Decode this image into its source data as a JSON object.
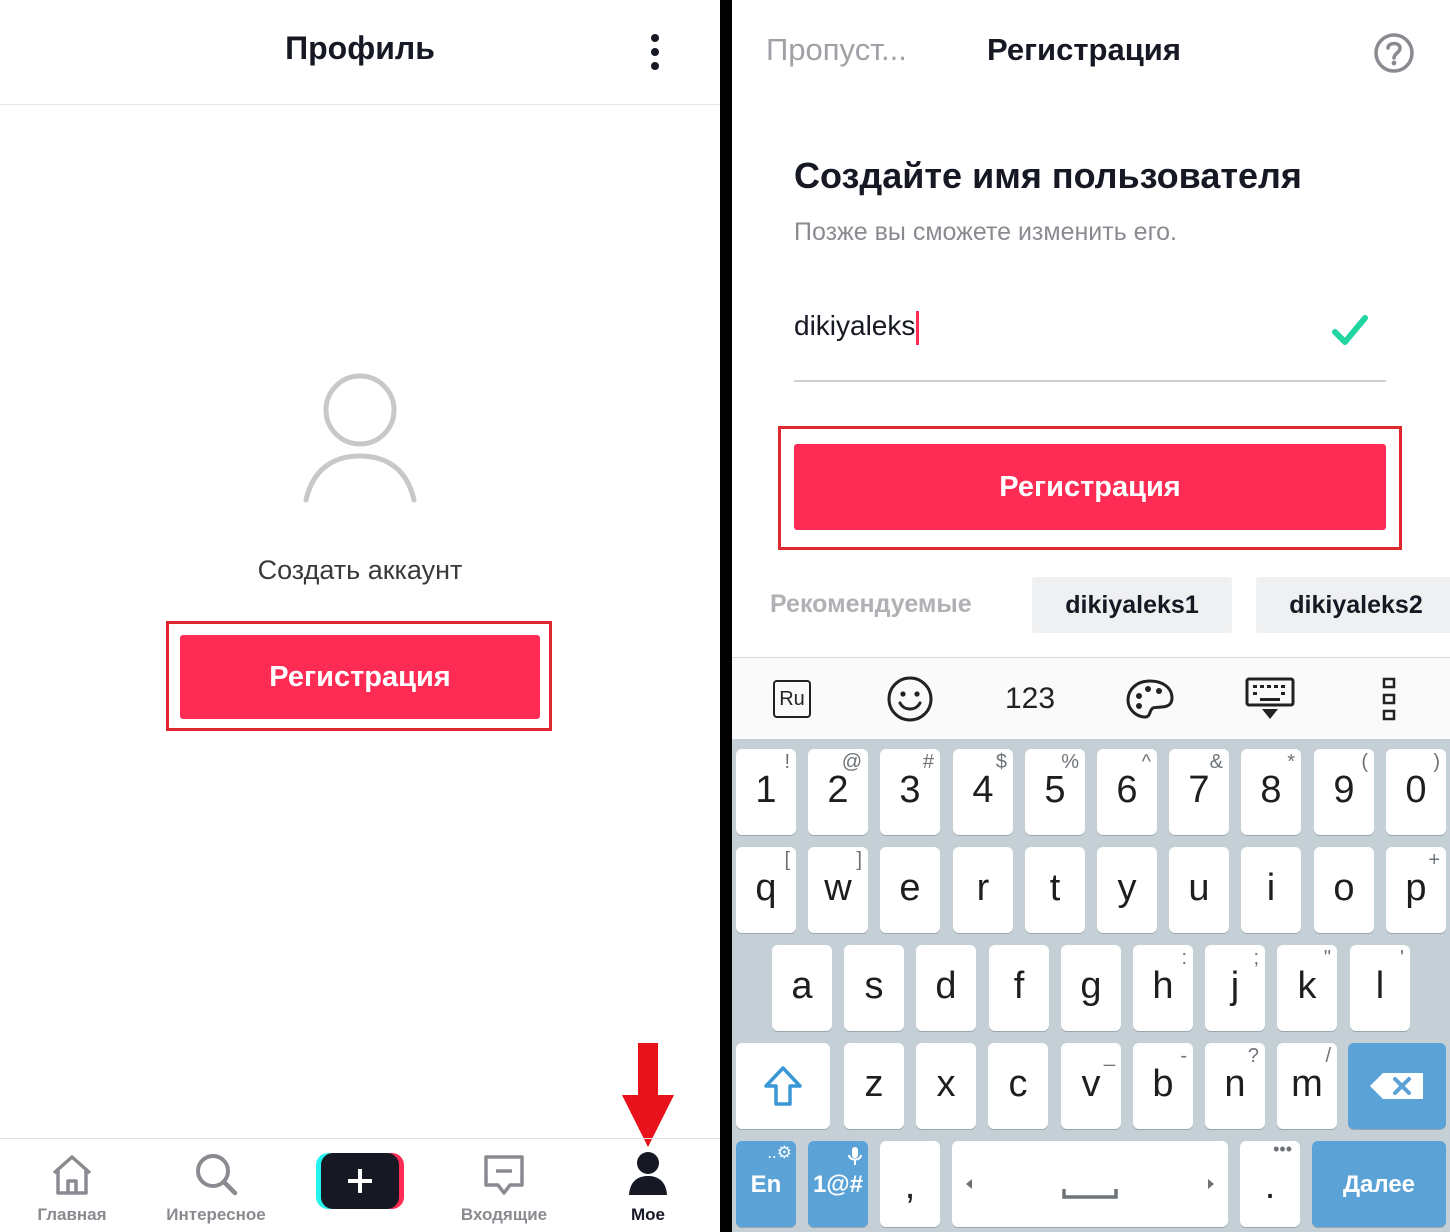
{
  "left": {
    "header": {
      "title": "Профиль"
    },
    "create_account_text": "Создать аккаунт",
    "register_button": "Регистрация",
    "tabs": [
      {
        "label": "Главная",
        "icon": "home-icon"
      },
      {
        "label": "Интересное",
        "icon": "search-icon"
      },
      {
        "label": "",
        "icon": "plus-icon"
      },
      {
        "label": "Входящие",
        "icon": "inbox-icon"
      },
      {
        "label": "Мое",
        "icon": "person-icon"
      }
    ],
    "active_tab": "Мое"
  },
  "right": {
    "header": {
      "skip": "Пропуст...",
      "title": "Регистрация"
    },
    "heading": "Создайте имя пользователя",
    "subheading": "Позже вы сможете изменить его.",
    "username_value": "dikiyaleks",
    "register_button": "Регистрация",
    "recommended_label": "Рекомендуемые",
    "suggestions": [
      "dikiyaleks1",
      "dikiyaleks2"
    ]
  },
  "keyboard": {
    "toolbar": {
      "lang": "Ru",
      "numbers": "123"
    },
    "row1": [
      {
        "k": "1",
        "s": "!"
      },
      {
        "k": "2",
        "s": "@"
      },
      {
        "k": "3",
        "s": "#"
      },
      {
        "k": "4",
        "s": "$"
      },
      {
        "k": "5",
        "s": "%"
      },
      {
        "k": "6",
        "s": "^"
      },
      {
        "k": "7",
        "s": "&"
      },
      {
        "k": "8",
        "s": "*"
      },
      {
        "k": "9",
        "s": "("
      },
      {
        "k": "0",
        "s": ")"
      }
    ],
    "row2": [
      {
        "k": "q",
        "s": "["
      },
      {
        "k": "w",
        "s": "]"
      },
      {
        "k": "e",
        "s": ""
      },
      {
        "k": "r",
        "s": ""
      },
      {
        "k": "t",
        "s": ""
      },
      {
        "k": "y",
        "s": ""
      },
      {
        "k": "u",
        "s": ""
      },
      {
        "k": "i",
        "s": ""
      },
      {
        "k": "o",
        "s": ""
      },
      {
        "k": "p",
        "s": "+"
      }
    ],
    "row3": [
      {
        "k": "a",
        "s": ""
      },
      {
        "k": "s",
        "s": ""
      },
      {
        "k": "d",
        "s": ""
      },
      {
        "k": "f",
        "s": ""
      },
      {
        "k": "g",
        "s": ""
      },
      {
        "k": "h",
        "s": ":"
      },
      {
        "k": "j",
        "s": ";"
      },
      {
        "k": "k",
        "s": "\""
      },
      {
        "k": "l",
        "s": "'"
      }
    ],
    "row4": [
      {
        "k": "z",
        "s": ""
      },
      {
        "k": "x",
        "s": ""
      },
      {
        "k": "c",
        "s": ""
      },
      {
        "k": "v",
        "s": "_"
      },
      {
        "k": "b",
        "s": "-"
      },
      {
        "k": "n",
        "s": "?"
      },
      {
        "k": "m",
        "s": "/"
      }
    ],
    "bottom": {
      "lang": "En",
      "symbols": "1@#",
      "comma": ",",
      "period": ".",
      "enter": "Далее",
      "lang_sup": "..⚙",
      "more_sup": "•••"
    }
  },
  "colors": {
    "accent": "#fe2c55",
    "highlight_outline": "#e0262f",
    "check": "#20d5a0",
    "keyboard_blue": "#5ba3d6"
  }
}
